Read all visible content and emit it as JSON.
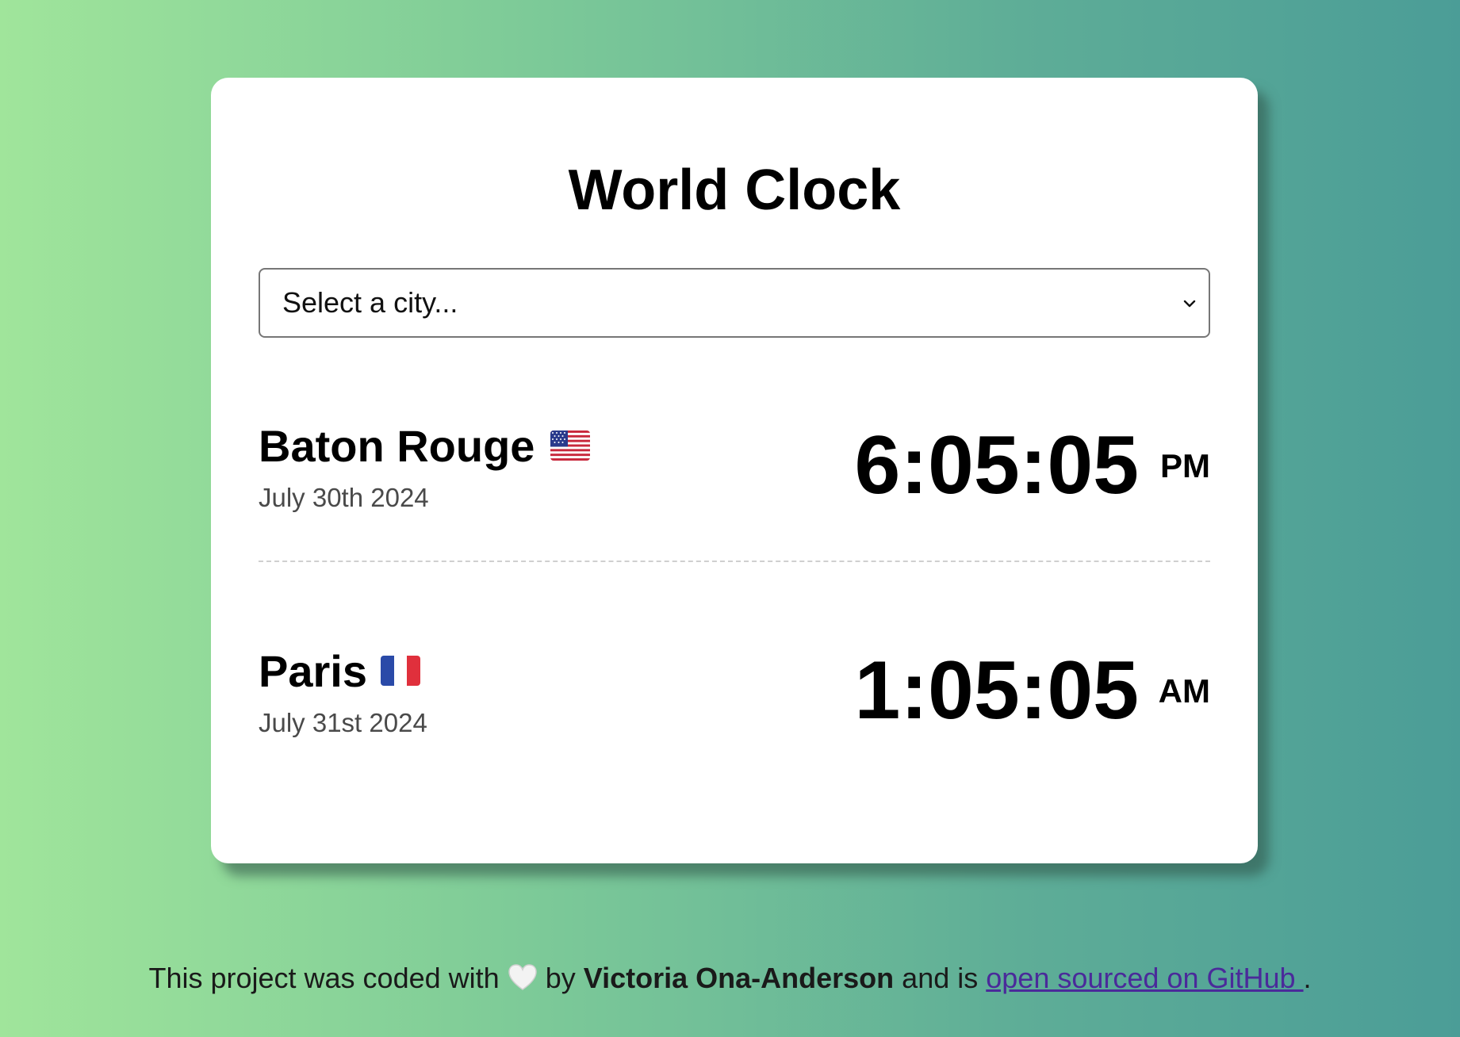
{
  "app": {
    "title": "World Clock"
  },
  "city_select": {
    "selected_label": "Select a city..."
  },
  "cities": [
    {
      "name": "Baton Rouge",
      "flag_icon": "us-flag-icon",
      "date": "July 30th 2024",
      "time": "6:05:05",
      "meridiem": "PM"
    },
    {
      "name": "Paris",
      "flag_icon": "france-flag-icon",
      "date": "July 31st 2024",
      "time": "1:05:05",
      "meridiem": "AM"
    }
  ],
  "footer": {
    "text_before": "This project was coded with",
    "heart_icon": "white-heart-icon",
    "by": "by",
    "author": "Victoria Ona-Anderson",
    "middle": "and is",
    "link_text": "open sourced on GitHub ",
    "end": "."
  },
  "colors": {
    "background_gradient": [
      "#a0e59b",
      "#4b9d97"
    ],
    "card": "#ffffff",
    "link": "#4a2a9a"
  }
}
